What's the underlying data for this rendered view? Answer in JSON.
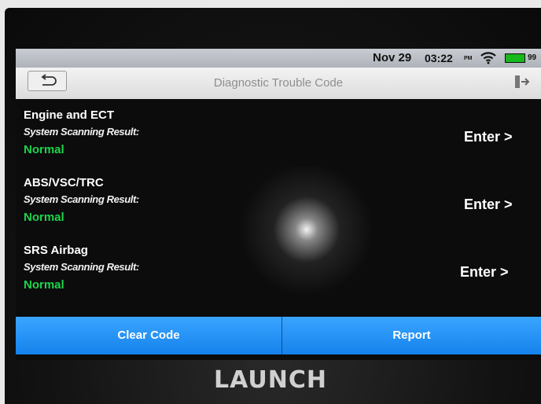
{
  "status_bar": {
    "date": "Nov 29",
    "time": "03:22",
    "ampm": "PM",
    "battery_text": "99",
    "wifi_icon": "wifi-icon",
    "battery_icon": "battery-icon",
    "battery_color": "#16b81c"
  },
  "header": {
    "title": "Diagnostic Trouble Code",
    "back_icon": "back-arrow-icon",
    "exit_icon": "exit-icon"
  },
  "systems": [
    {
      "name": "Engine and ECT",
      "subtitle": "System Scanning Result:",
      "status": "Normal",
      "action": "Enter >"
    },
    {
      "name": "ABS/VSC/TRC",
      "subtitle": "System Scanning Result:",
      "status": "Normal",
      "action": "Enter >"
    },
    {
      "name": "SRS Airbag",
      "subtitle": "System Scanning Result:",
      "status": "Normal",
      "action": "Enter >"
    }
  ],
  "footer": {
    "clear_code_label": "Clear Code",
    "report_label": "Report",
    "accent_color": "#1582ec"
  },
  "brand": "LAUNCH",
  "colors": {
    "status_normal": "#1ed34a",
    "screen_bg": "#0c0c0d"
  }
}
